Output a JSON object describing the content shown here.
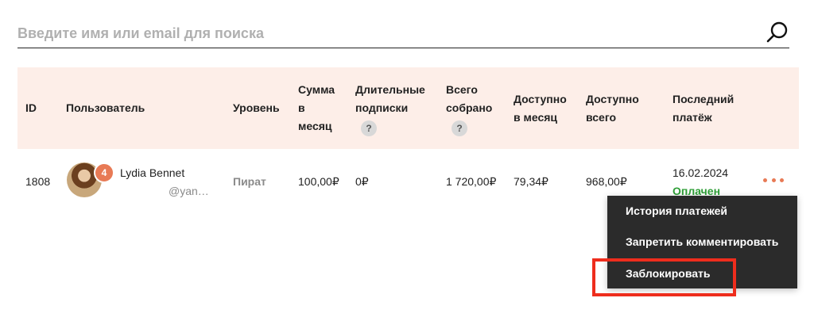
{
  "search": {
    "placeholder": "Введите имя или email для поиска"
  },
  "table": {
    "headers": [
      {
        "label": "ID"
      },
      {
        "label": "Пользователь"
      },
      {
        "label": "Уровень"
      },
      {
        "label": "Сумма\nв\nмесяц"
      },
      {
        "label": "Длительные\nподписки",
        "help": "?"
      },
      {
        "label": "Всего\nсобрано",
        "help": "?"
      },
      {
        "label": "Доступно\nв месяц"
      },
      {
        "label": "Доступно\nвсего"
      },
      {
        "label": "Последний\nплатёж"
      }
    ],
    "rows": [
      {
        "id": "1808",
        "user_name": "Lydia Bennet",
        "user_handle": "@yan…",
        "badge_count": "4",
        "level": "Пират",
        "monthly_sum": "100,00₽",
        "long_subscriptions": "0₽",
        "total_collected": "1 720,00₽",
        "available_monthly": "79,34₽",
        "available_total": "968,00₽",
        "last_payment_date": "16.02.2024",
        "last_payment_status": "Оплачен"
      }
    ]
  },
  "context_menu": {
    "items": [
      {
        "label": "История платежей"
      },
      {
        "label": "Запретить комментировать"
      },
      {
        "label": "Заблокировать"
      }
    ]
  },
  "colors": {
    "header_bg": "#fdeee8",
    "accent": "#e87a55",
    "paid": "#2e9e36",
    "menu_bg": "#2b2b2b",
    "highlight": "#ee2d1d"
  }
}
